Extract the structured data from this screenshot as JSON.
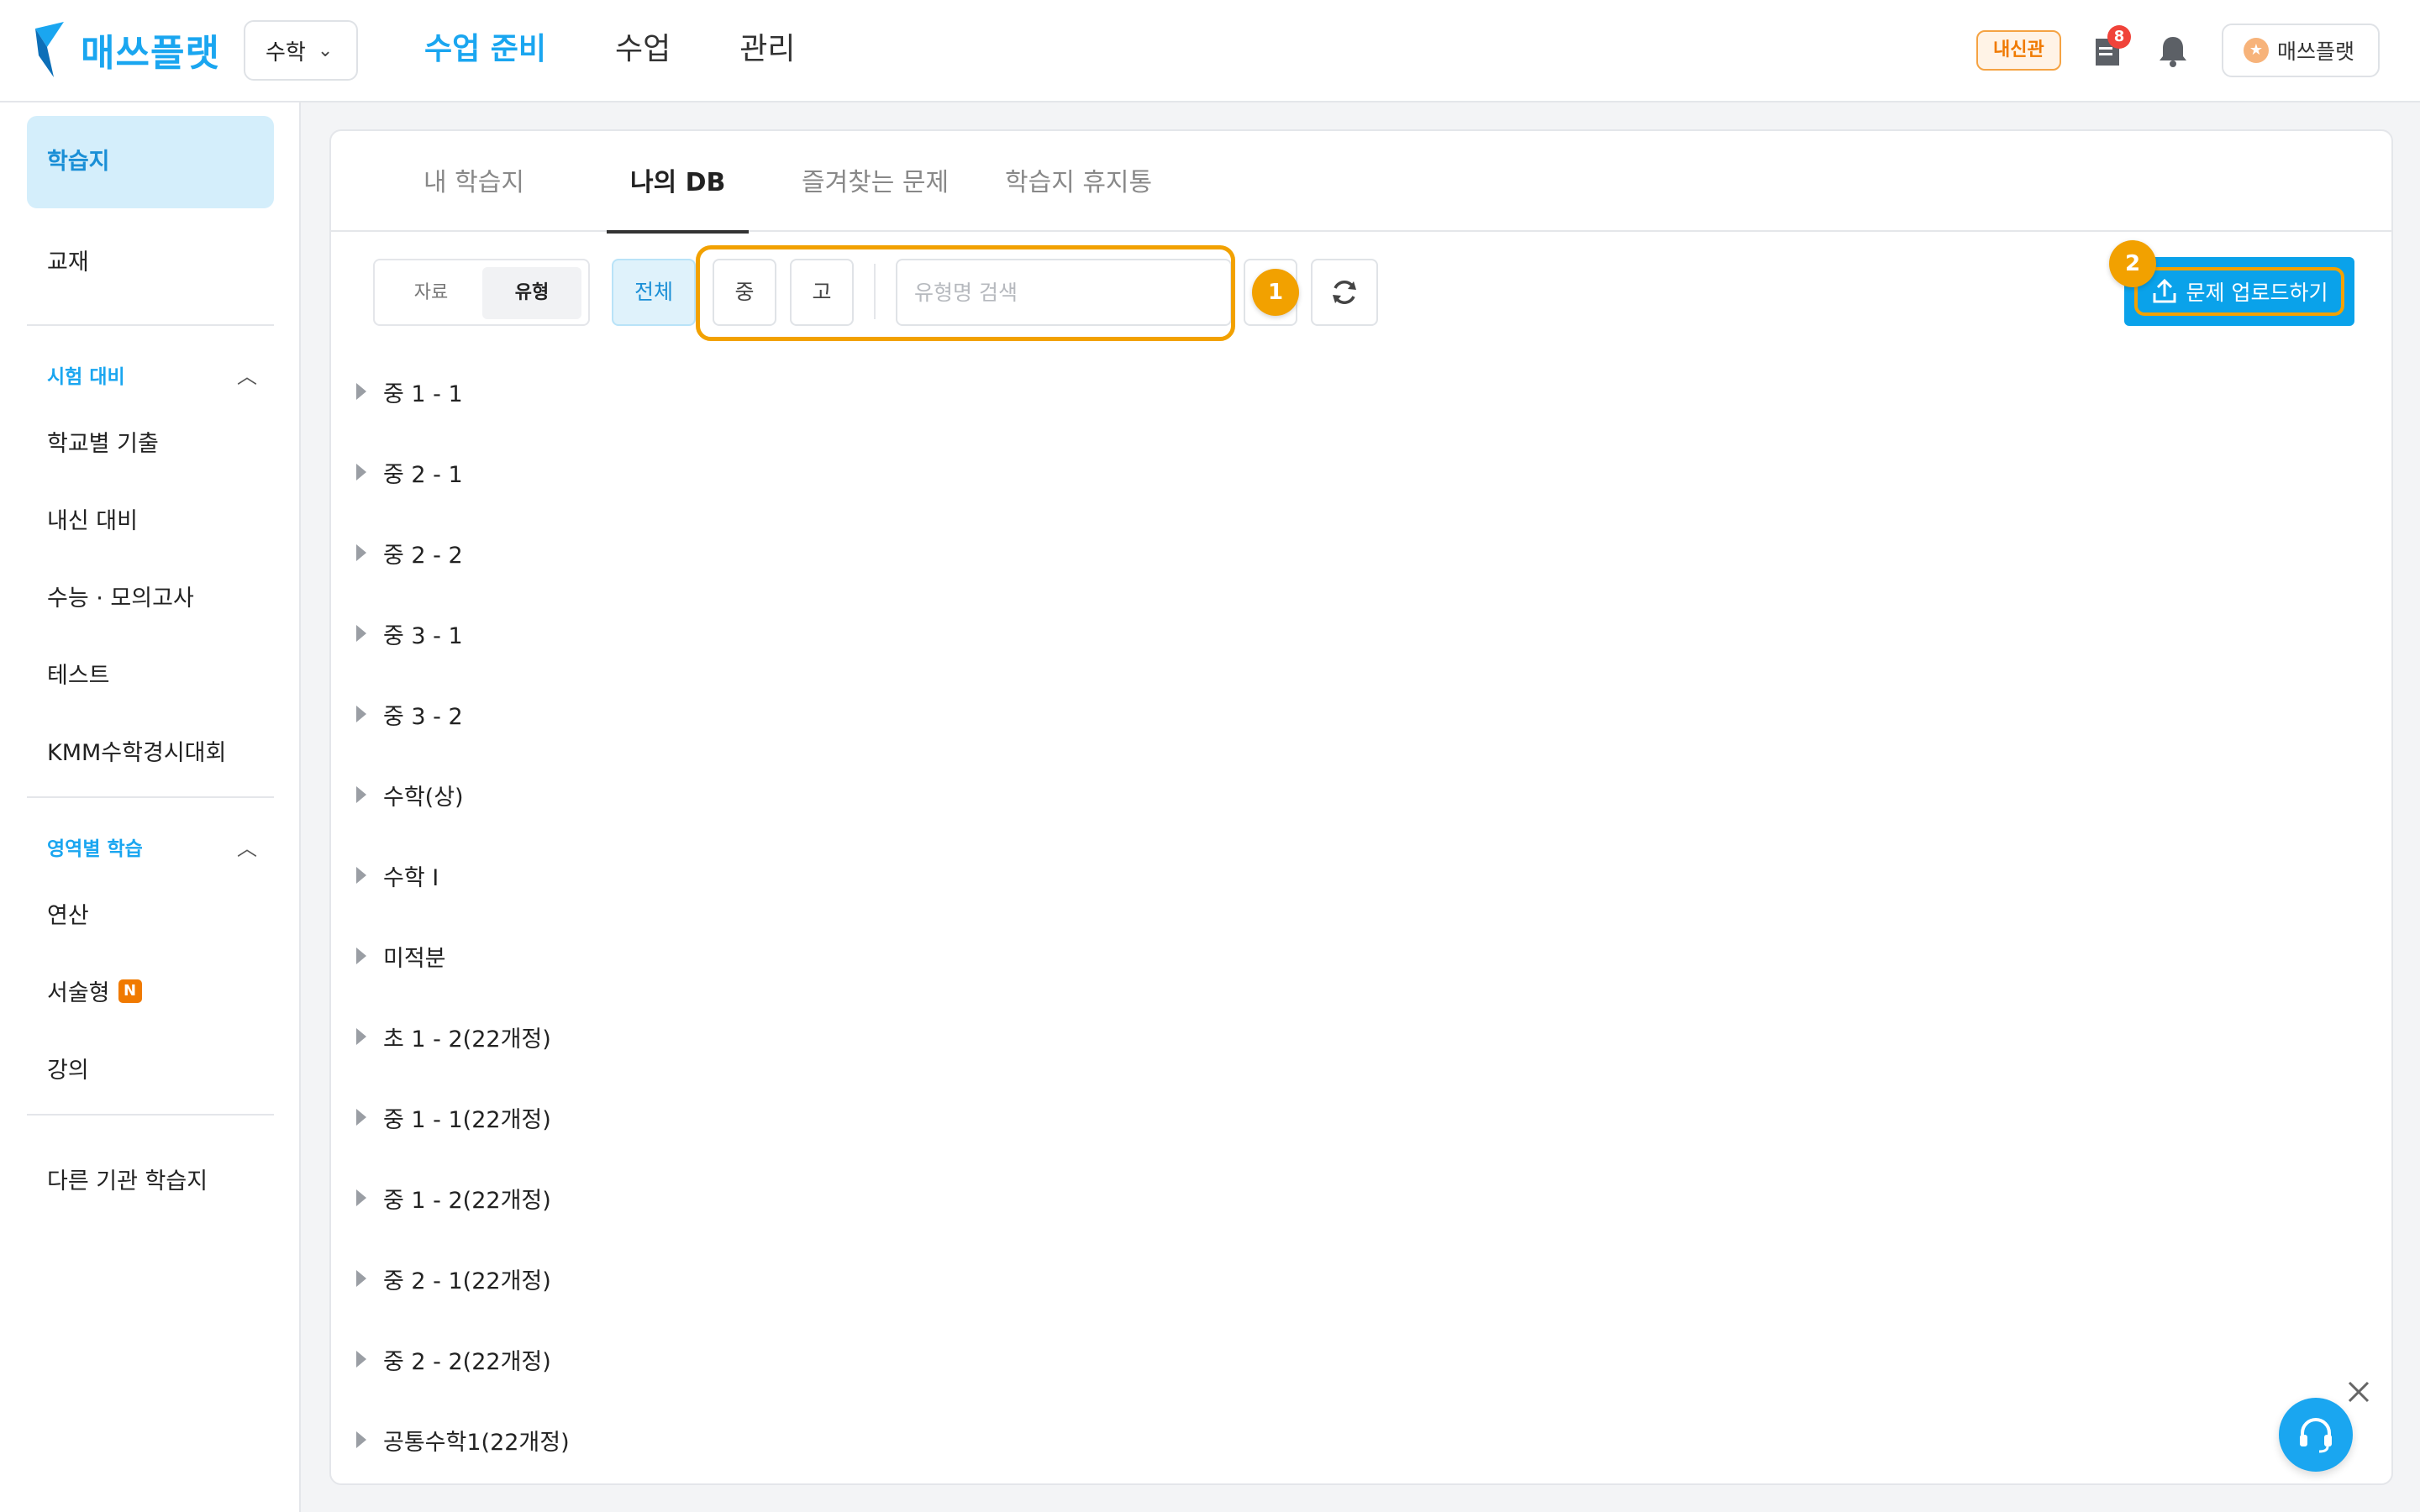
{
  "header": {
    "logo_text": "매쓰플랫",
    "subject": "수학",
    "nav": [
      "수업 준비",
      "수업",
      "관리"
    ],
    "active_nav": "수업 준비",
    "naesingwan": "내신관",
    "notification_count": "8",
    "profile_label": "매쓰플랫",
    "brand_color": "#1aa6f0"
  },
  "sidebar": {
    "top_items": [
      "학습지",
      "교재"
    ],
    "section1": {
      "title": "시험 대비",
      "items": [
        "학교별 기출",
        "내신 대비",
        "수능 · 모의고사",
        "테스트",
        "KMM수학경시대회"
      ]
    },
    "section2": {
      "title": "영역별 학습",
      "items": [
        "연산",
        "서술형",
        "강의"
      ],
      "new_badge": "N"
    },
    "bottom_item": "다른 기관 학습지"
  },
  "tabs": [
    "내 학습지",
    "나의 DB",
    "즐겨찾는 문제",
    "학습지 휴지통"
  ],
  "active_tab": "나의 DB",
  "toolbar": {
    "segment": [
      "자료",
      "유형"
    ],
    "active_segment": "유형",
    "filters": [
      "전체",
      "중",
      "고"
    ],
    "active_filter": "전체",
    "search_placeholder": "유형명 검색",
    "upload_label": "문제 업로드하기",
    "marker1": "1",
    "marker2": "2",
    "highlight_color": "#f2a100"
  },
  "tree": [
    "중 1 - 1",
    "중 2 - 1",
    "중 2 - 2",
    "중 3 - 1",
    "중 3 - 2",
    "수학(상)",
    "수학 I",
    "미적분",
    "초 1 - 2(22개정)",
    "중 1 - 1(22개정)",
    "중 1 - 2(22개정)",
    "중 2 - 1(22개정)",
    "중 2 - 2(22개정)",
    "공통수학1(22개정)"
  ]
}
